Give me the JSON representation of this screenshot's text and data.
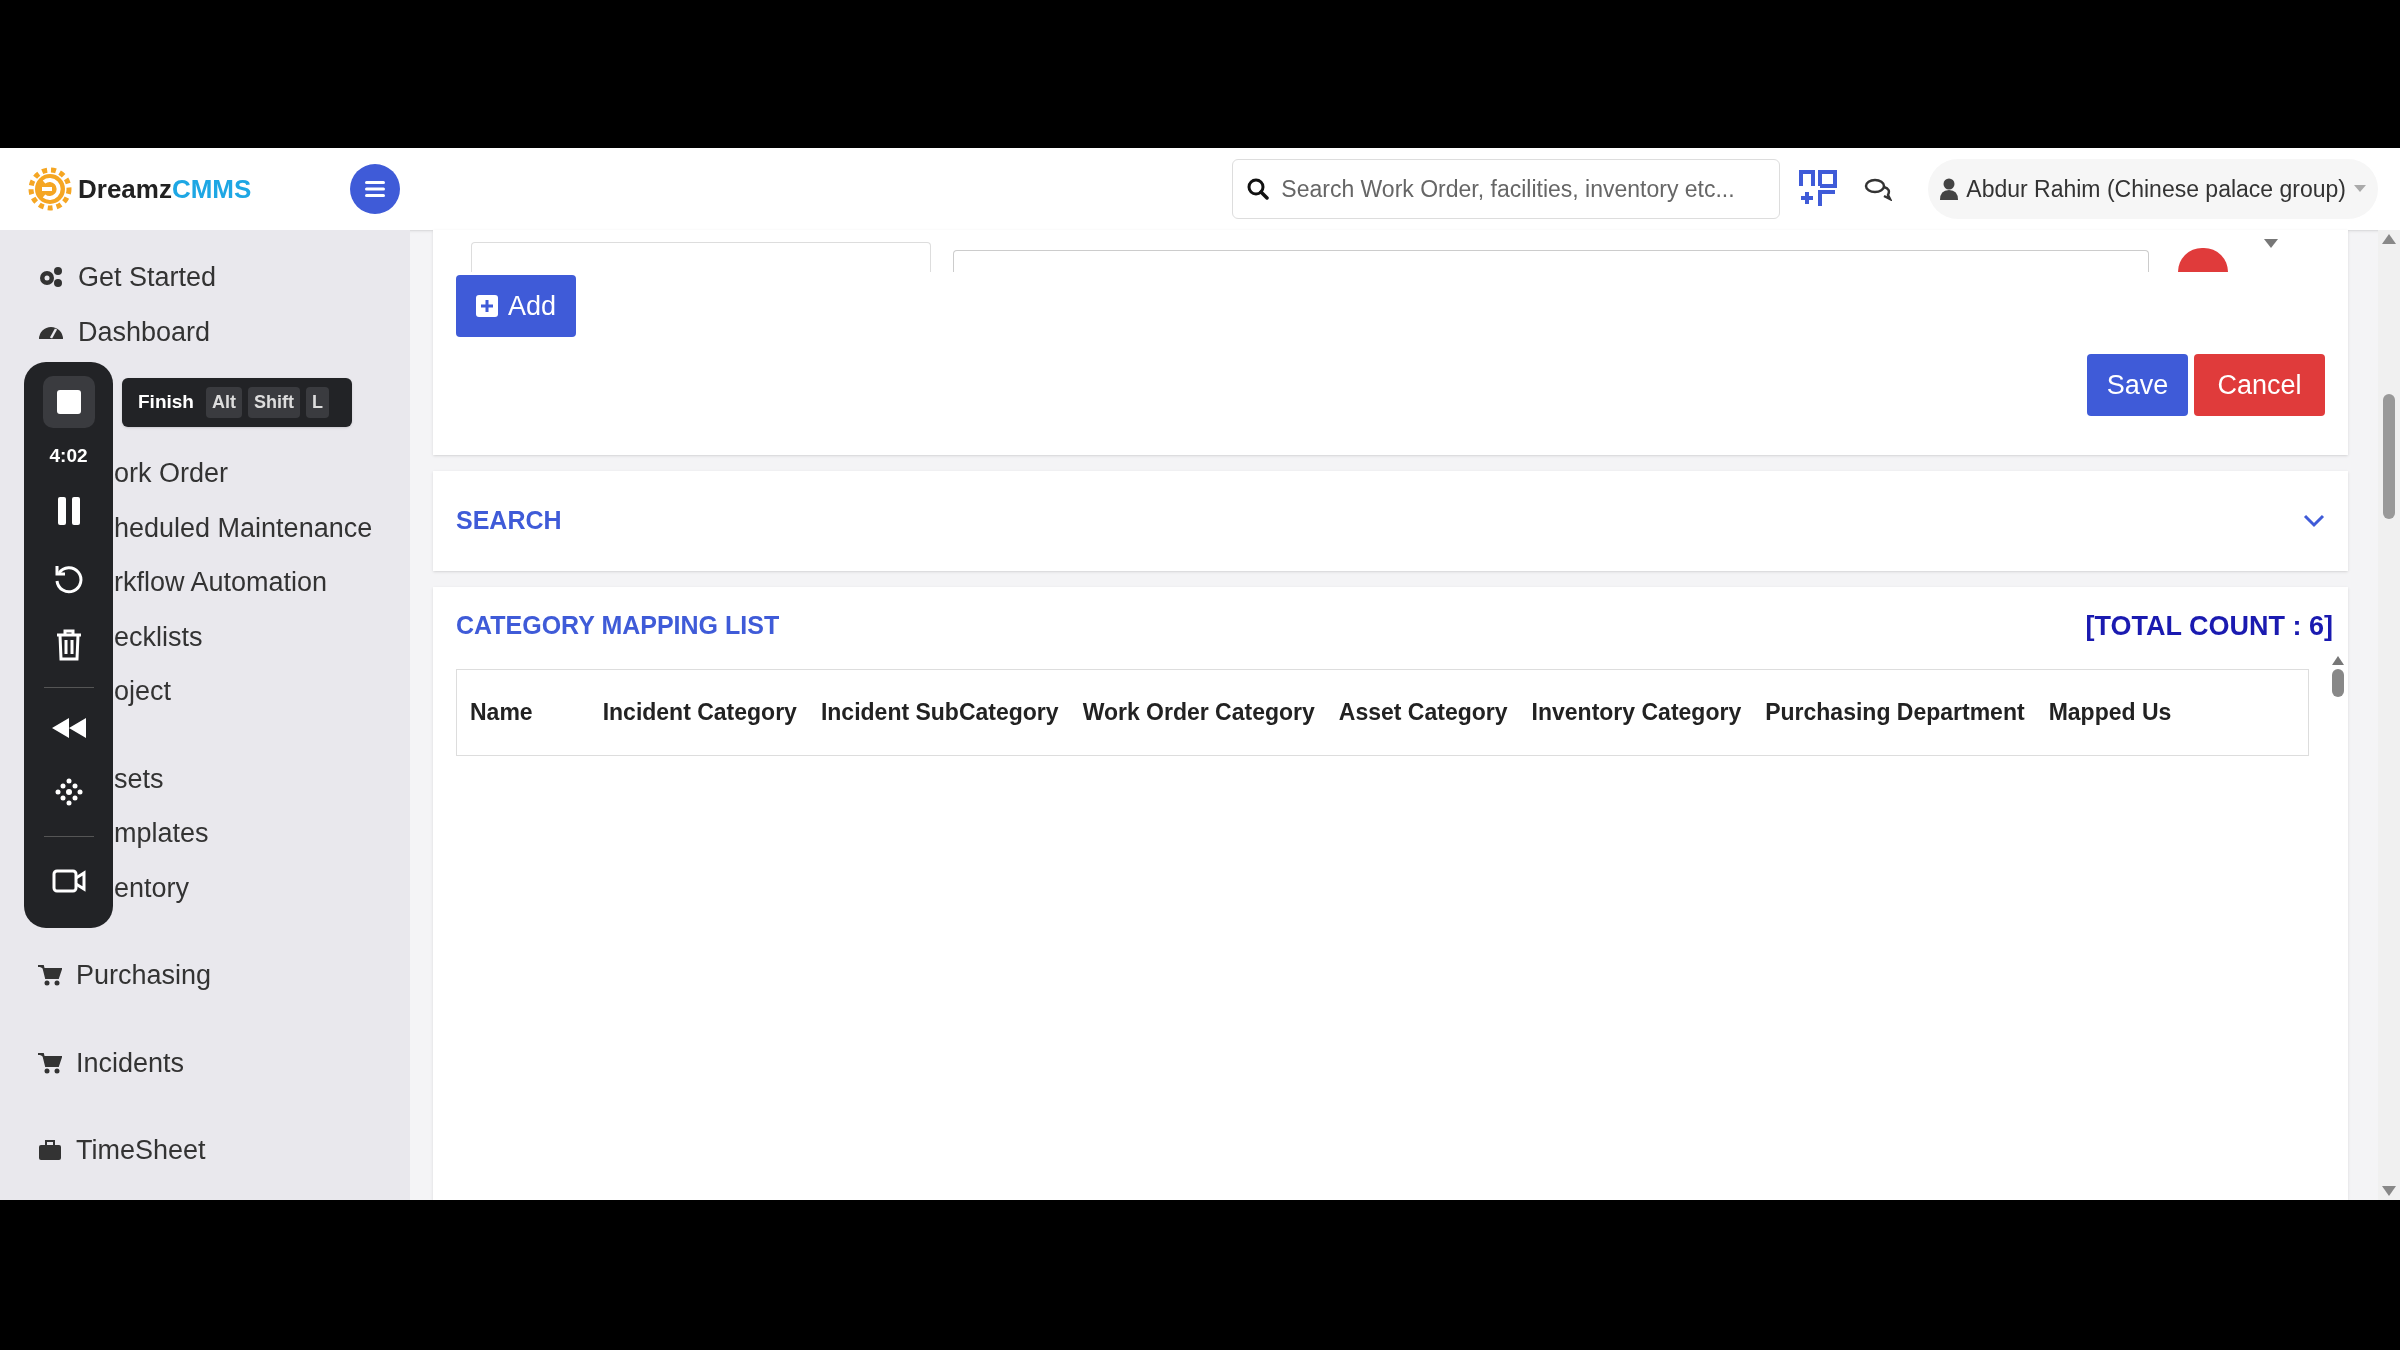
{
  "header": {
    "brand": {
      "part1": "Dreamz",
      "part2": "CMMS"
    },
    "search": {
      "placeholder": "Search Work Order, facilities, inventory etc..."
    },
    "user": "Abdur Rahim (Chinese palace group)"
  },
  "sidebar": {
    "items": [
      {
        "label": "Get Started",
        "kind": "full"
      },
      {
        "label": "Dashboard",
        "kind": "full"
      },
      {
        "label": "ork Order",
        "kind": "covered"
      },
      {
        "label": "heduled Maintenance",
        "kind": "covered"
      },
      {
        "label": "rkflow Automation",
        "kind": "covered"
      },
      {
        "label": "ecklists",
        "kind": "covered"
      },
      {
        "label": "oject",
        "kind": "covered"
      },
      {
        "label": "sets",
        "kind": "covered"
      },
      {
        "label": "mplates",
        "kind": "covered"
      },
      {
        "label": "entory",
        "kind": "covered"
      },
      {
        "label": "Purchasing",
        "kind": "full"
      },
      {
        "label": "Incidents",
        "kind": "full"
      },
      {
        "label": "TimeSheet",
        "kind": "full"
      }
    ]
  },
  "recorder": {
    "time": "4:02",
    "tooltip": {
      "label": "Finish",
      "keys": [
        "Alt",
        "Shift",
        "L"
      ]
    }
  },
  "form": {
    "add_button": "Add",
    "save_button": "Save",
    "cancel_button": "Cancel"
  },
  "search_panel": {
    "title": "SEARCH",
    "expanded": false
  },
  "list": {
    "title": "CATEGORY MAPPING LIST",
    "total": "[TOTAL COUNT : 6]",
    "columns": [
      "Name",
      "Incident Category",
      "Incident SubCategory",
      "Work Order Category",
      "Asset Category",
      "Inventory Category",
      "Purchasing Department",
      "Mapped Us"
    ]
  }
}
